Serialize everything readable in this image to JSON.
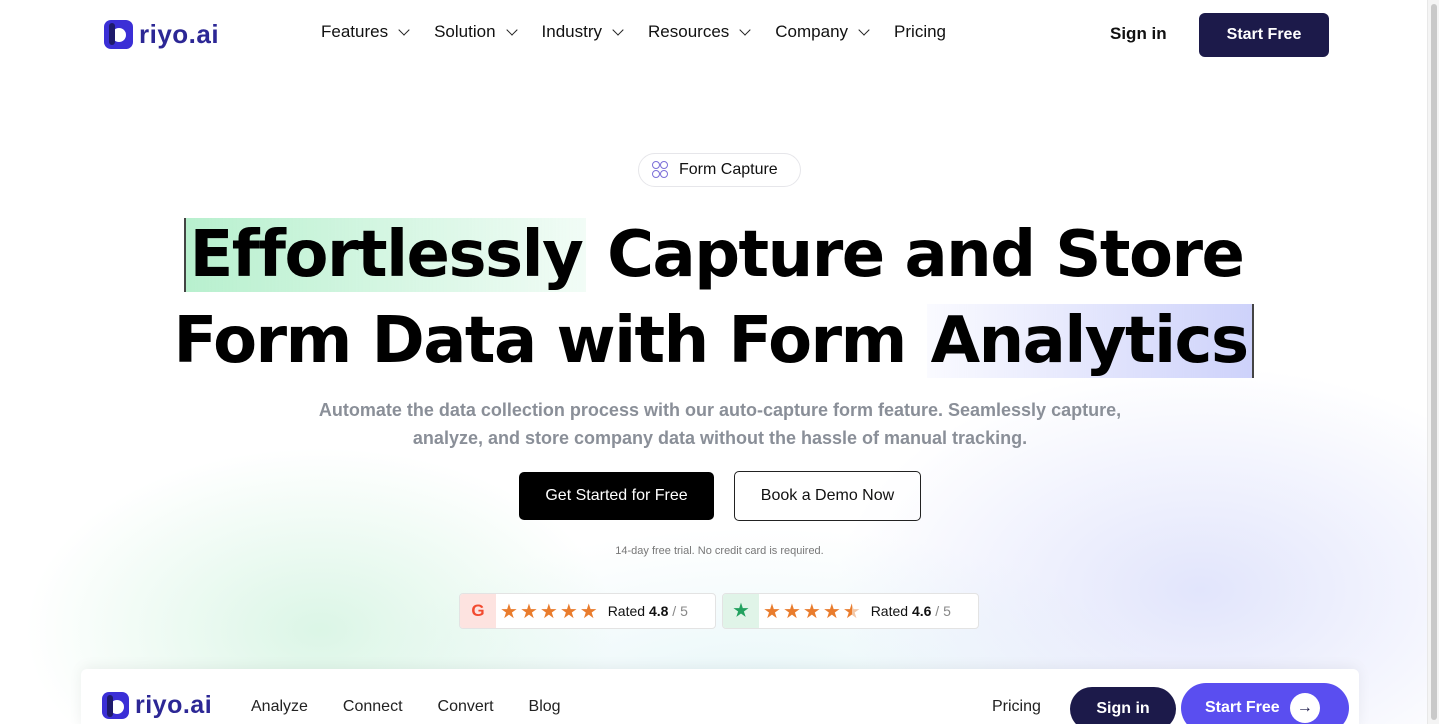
{
  "header": {
    "logo_text": "riyo.ai",
    "nav": [
      {
        "label": "Features",
        "has_dropdown": true
      },
      {
        "label": "Solution",
        "has_dropdown": true
      },
      {
        "label": "Industry",
        "has_dropdown": true
      },
      {
        "label": "Resources",
        "has_dropdown": true
      },
      {
        "label": "Company",
        "has_dropdown": true
      },
      {
        "label": "Pricing",
        "has_dropdown": false
      }
    ],
    "sign_in": "Sign in",
    "start_free": "Start Free"
  },
  "hero": {
    "pill_label": "Form Capture",
    "headline_highlight_1": "Effortlessly",
    "headline_line1_rest": "Capture and Store",
    "headline_line2_start": "Form Data with Form",
    "headline_highlight_2": "Analytics",
    "subtitle_line1": "Automate the data collection process with our auto-capture form feature. Seamlessly capture,",
    "subtitle_line2": "analyze, and store company data without the hassle of manual tracking.",
    "primary_cta": "Get Started for Free",
    "secondary_cta": "Book a Demo Now",
    "trial_note": "14-day free trial. No credit card is required."
  },
  "ratings": [
    {
      "source_icon": "g2-icon",
      "badge_glyph": "G",
      "stars": 5,
      "prefix": "Rated",
      "score": "4.8",
      "suffix": "/ 5"
    },
    {
      "source_icon": "trustpilot-icon",
      "badge_glyph": "★",
      "stars": 4.5,
      "prefix": "Rated",
      "score": "4.6",
      "suffix": "/ 5"
    }
  ],
  "preview": {
    "logo_text": "riyo.ai",
    "nav": [
      "Analyze",
      "Connect",
      "Convert",
      "Blog"
    ],
    "pricing": "Pricing",
    "sign_in": "Sign in",
    "start_free": "Start Free",
    "arrow": "→"
  },
  "colors": {
    "brand": "#2c2795",
    "dark_button": "#1c1a4a",
    "accent_purple": "#5a4ef0",
    "highlight_green": "#a0ebbe",
    "highlight_blue": "#c8cdfa",
    "star": "#e97c2d"
  }
}
